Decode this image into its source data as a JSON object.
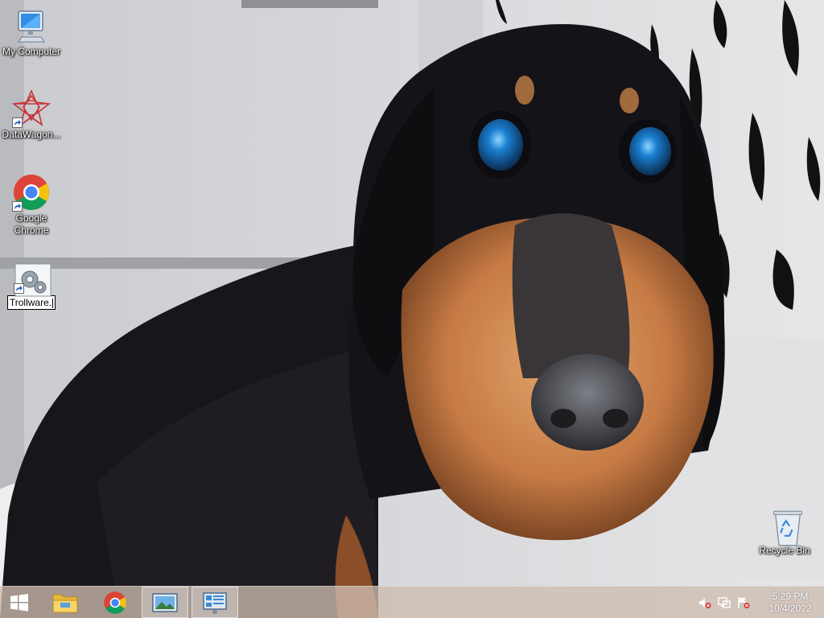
{
  "desktop": {
    "icons": [
      {
        "label": "My Computer",
        "icon": "computer-icon",
        "shortcut": false
      },
      {
        "label": "DataWagon...",
        "icon": "datawagon-icon",
        "shortcut": true
      },
      {
        "label": "Google Chrome",
        "icon": "chrome-icon",
        "shortcut": true
      },
      {
        "label": "Trollware.",
        "icon": "gear-app-icon",
        "shortcut": true,
        "renaming": true
      },
      {
        "label": "Recycle Bin",
        "icon": "recycle-bin-icon",
        "shortcut": false
      }
    ]
  },
  "taskbar": {
    "buttons": [
      {
        "name": "start",
        "icon": "windows-logo-icon"
      },
      {
        "name": "file-explorer",
        "icon": "folder-icon"
      },
      {
        "name": "google-chrome",
        "icon": "chrome-icon"
      },
      {
        "name": "picture-window",
        "icon": "picture-icon",
        "active": true
      },
      {
        "name": "control-window",
        "icon": "control-panel-icon",
        "active": true
      }
    ],
    "tray": {
      "icons": [
        "volume-muted-icon",
        "network-icon",
        "action-center-flag-icon"
      ],
      "time": "5:29 PM",
      "date": "10/4/2022"
    }
  },
  "colors": {
    "taskbar": "#cdbcb0",
    "label_text": "#ffffff",
    "chrome_red": "#db4437",
    "chrome_yellow": "#f4c20d",
    "chrome_green": "#0f9d58",
    "chrome_blue": "#4285f4"
  }
}
